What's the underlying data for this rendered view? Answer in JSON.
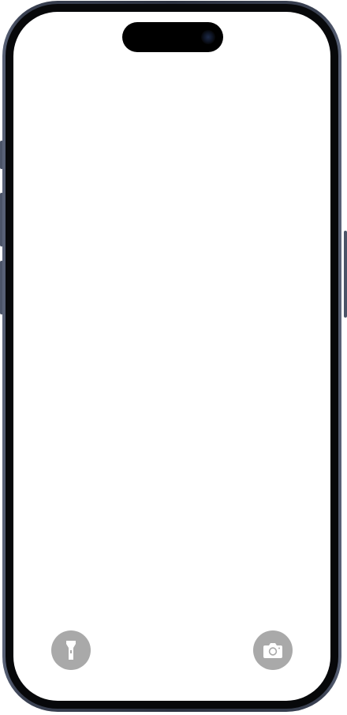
{
  "device": {
    "model": "phone",
    "frame_color": "#2c3240",
    "screen_color": "#ffffff"
  },
  "lock_screen": {
    "left_shortcut": {
      "icon": "flashlight-icon",
      "color": "#a9a9a9"
    },
    "right_shortcut": {
      "icon": "camera-icon",
      "color": "#a9a9a9"
    }
  }
}
